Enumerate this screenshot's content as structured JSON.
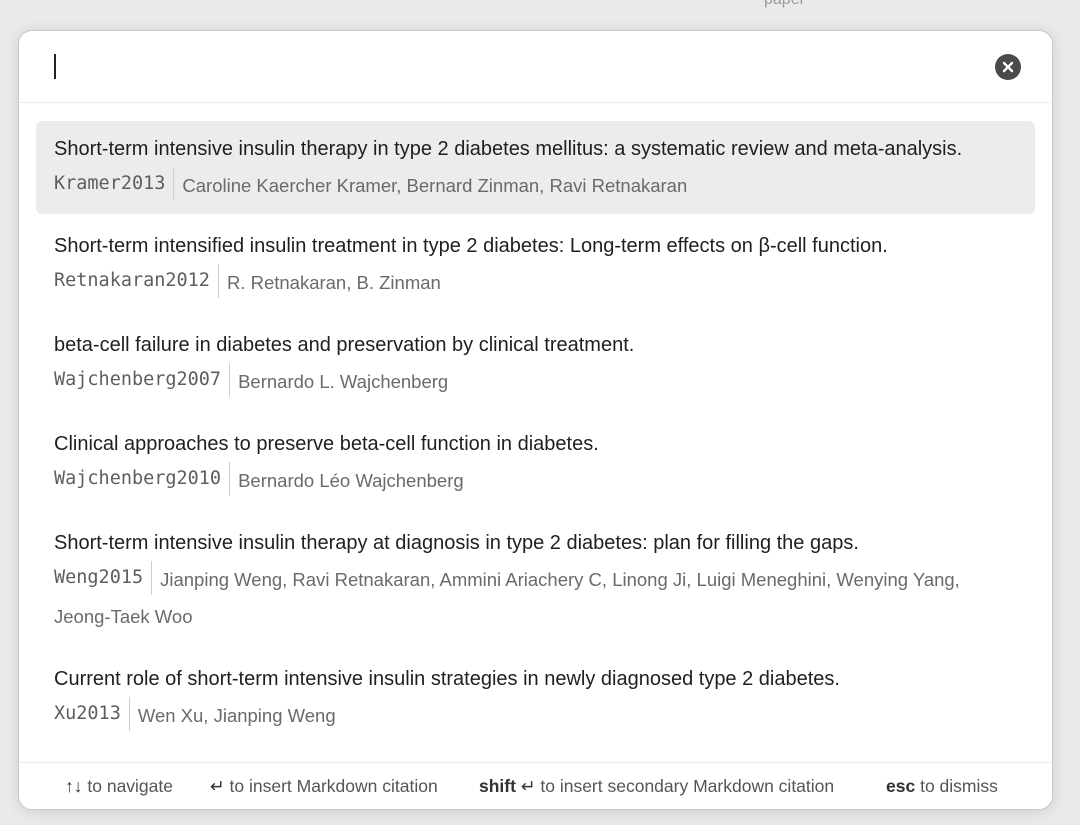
{
  "background": {
    "partial_text": "paper"
  },
  "search": {
    "value": "",
    "clear_icon": "circle-x-icon"
  },
  "results": [
    {
      "title": "Short-term intensive insulin therapy in type 2 diabetes mellitus: a systematic review and meta-analysis.",
      "key": "Kramer2013",
      "authors": "Caroline Kaercher Kramer, Bernard Zinman, Ravi Retnakaran",
      "selected": true
    },
    {
      "title": "Short-term intensified insulin treatment in type 2 diabetes: Long-term effects on β-cell function.",
      "key": "Retnakaran2012",
      "authors": "R. Retnakaran, B. Zinman",
      "selected": false
    },
    {
      "title": "beta-cell failure in diabetes and preservation by clinical treatment.",
      "key": "Wajchenberg2007",
      "authors": "Bernardo L. Wajchenberg",
      "selected": false
    },
    {
      "title": "Clinical approaches to preserve beta-cell function in diabetes.",
      "key": "Wajchenberg2010",
      "authors": "Bernardo Léo Wajchenberg",
      "selected": false
    },
    {
      "title": "Short-term intensive insulin therapy at diagnosis in type 2 diabetes: plan for filling the gaps.",
      "key": "Weng2015",
      "authors": "Jianping Weng, Ravi Retnakaran, Ammini Ariachery C, Linong Ji, Luigi Meneghini, Wenying Yang, Jeong-Taek Woo",
      "selected": false
    },
    {
      "title": "Current role of short-term intensive insulin strategies in newly diagnosed type 2 diabetes.",
      "key": "Xu2013",
      "authors": "Wen Xu, Jianping Weng",
      "selected": false
    }
  ],
  "footer": {
    "navigate_keys": "↑↓",
    "navigate_text": "to navigate",
    "insert_key": "↵",
    "insert_text": "to insert Markdown citation",
    "secondary_mod": "shift",
    "secondary_key": "↵",
    "secondary_text": "to insert secondary Markdown citation",
    "dismiss_key": "esc",
    "dismiss_text": "to dismiss"
  }
}
